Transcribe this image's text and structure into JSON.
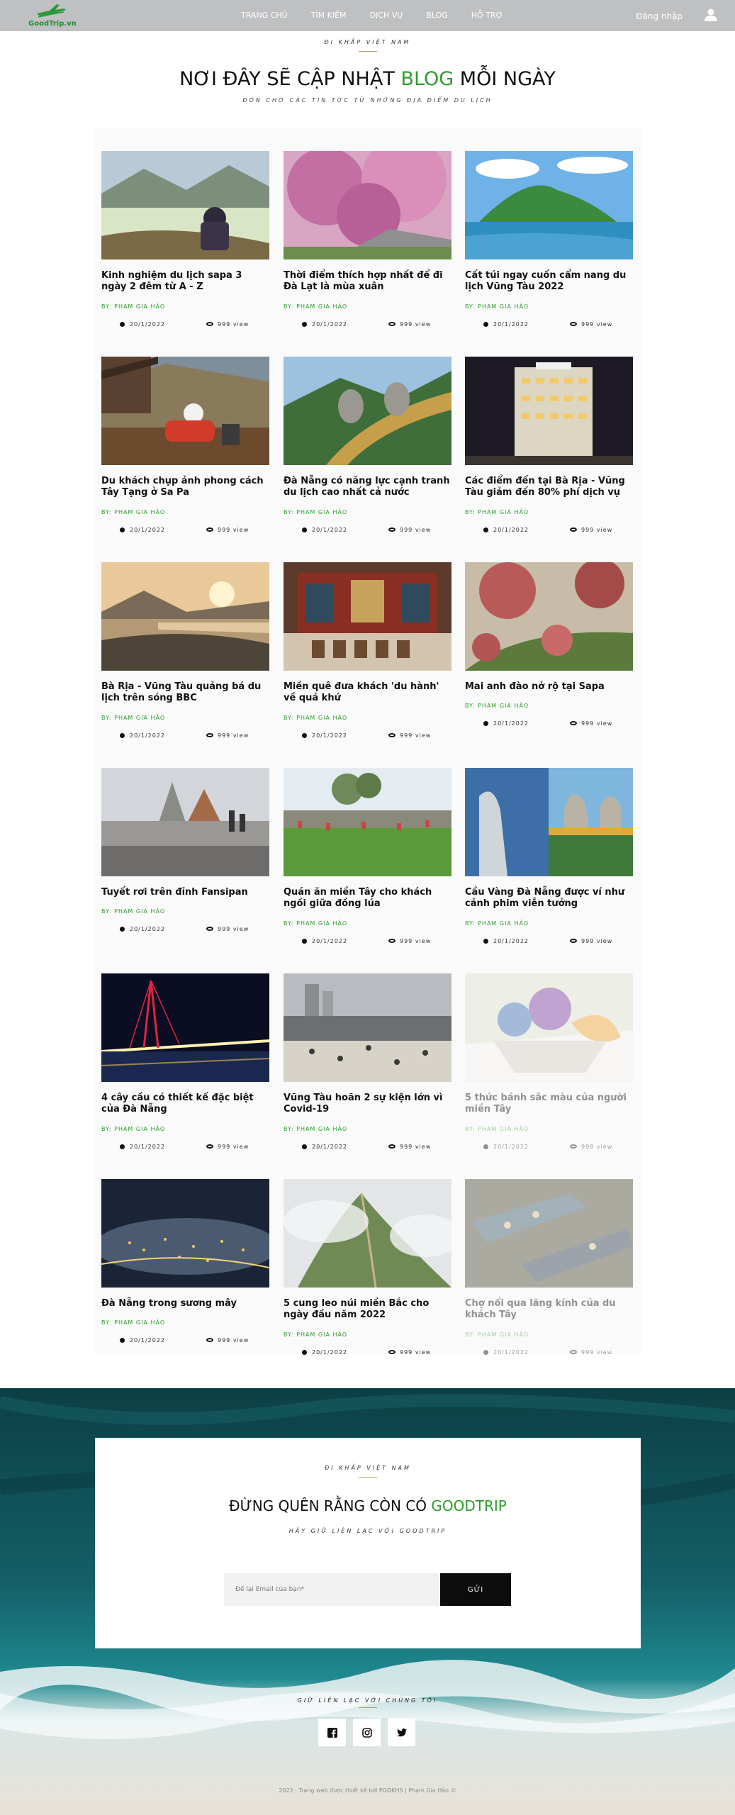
{
  "header": {
    "logo_text": "GoodTrip.vn",
    "nav": [
      "TRANG CHỦ",
      "TÌM KIẾM",
      "DỊCH VỤ",
      "BLOG",
      "HỖ TRỢ"
    ],
    "login_label": "Đăng nhập",
    "icons": {
      "logo": "plane-icon",
      "user": "user-icon"
    }
  },
  "hero": {
    "eyebrow": "ĐI KHẮP VIỆT NAM",
    "title_before": "NƠI ĐÂY SẼ CẬP NHẬT",
    "title_accent": "BLOG",
    "title_after": "MỖI NGÀY",
    "subtitle": "ĐÓN CHỜ CÁC TIN TỨC TỪ NHỮNG ĐỊA ĐIỂM DU LỊCH"
  },
  "posts": [
    {
      "title": "Kinh nghiệm du lịch sapa 3 ngày 2 đêm từ A - Z",
      "author": "BY: PHAM GIA HẢO",
      "date": "20/1/2022",
      "views": "999 view"
    },
    {
      "title": "Thời điểm thích hợp nhất để đi Đà Lạt là mùa xuân",
      "author": "BY: PHAM GIA HẢO",
      "date": "20/1/2022",
      "views": "999 view"
    },
    {
      "title": "Cất túi ngay cuốn cẩm nang du lịch Vũng Tàu 2022",
      "author": "BY: PHAM GIA HẢO",
      "date": "20/1/2022",
      "views": "999 view"
    },
    {
      "title": "Du khách chụp ảnh phong cách Tây Tạng ở Sa Pa",
      "author": "BY: PHAM GIA HẢO",
      "date": "20/1/2022",
      "views": "999 view"
    },
    {
      "title": "Đà Nẵng có năng lực cạnh tranh du lịch cao nhất cả nước",
      "author": "BY: PHAM GIA HẢO",
      "date": "20/1/2022",
      "views": "999 view"
    },
    {
      "title": "Các điểm đến tại Bà Rịa - Vũng Tàu giảm đến 80% phí dịch vụ",
      "author": "BY: PHAM GIA HẢO",
      "date": "20/1/2022",
      "views": "999 view"
    },
    {
      "title": "Bà Rịa - Vũng Tàu quảng bá du lịch trên sóng BBC",
      "author": "BY: PHAM GIA HẢO",
      "date": "20/1/2022",
      "views": "999 view"
    },
    {
      "title": "Miền quê đưa khách 'du hành' về quá khứ",
      "author": "BY: PHAM GIA HẢO",
      "date": "20/1/2022",
      "views": "999 view"
    },
    {
      "title": "Mai anh đào nở rộ tại Sapa",
      "author": "BY: PHAM GIA HẢO",
      "date": "20/1/2022",
      "views": "999 view"
    },
    {
      "title": "Tuyết rơi trên đỉnh Fansipan",
      "author": "BY: PHAM GIA HẢO",
      "date": "20/1/2022",
      "views": "999 view"
    },
    {
      "title": "Quán ăn miền Tây cho khách ngồi giữa đồng lúa",
      "author": "BY: PHAM GIA HẢO",
      "date": "20/1/2022",
      "views": "999 view"
    },
    {
      "title": "Cầu Vàng Đà Nẵng được ví như cảnh phim viễn tưởng",
      "author": "BY: PHAM GIA HẢO",
      "date": "20/1/2022",
      "views": "999 view"
    },
    {
      "title": "4 cây cầu có thiết kế đặc biệt của Đà Nẵng",
      "author": "BY: PHAM GIA HẢO",
      "date": "20/1/2022",
      "views": "999 view"
    },
    {
      "title": "Vũng Tàu hoãn 2 sự kiện lớn vì Covid-19",
      "author": "BY: PHAM GIA HẢO",
      "date": "20/1/2022",
      "views": "999 view"
    },
    {
      "title": "5 thức bánh sắc màu của người miền Tây",
      "author": "BY: PHAM GIA HẢO",
      "date": "20/1/2022",
      "views": "999 view"
    },
    {
      "title": "Đà Nẵng trong sương mây",
      "author": "BY: PHAM GIA HẢO",
      "date": "20/1/2022",
      "views": "999 view"
    },
    {
      "title": "5 cung leo núi miền Bắc cho ngày đầu năm 2022",
      "author": "BY: PHAM GIA HẢO",
      "date": "20/1/2022",
      "views": "999 view"
    },
    {
      "title": "Chợ nổi qua lăng kính của du khách Tây",
      "author": "BY: PHAM GIA HẢO",
      "date": "20/1/2022",
      "views": "999 view"
    }
  ],
  "subscribe": {
    "eyebrow": "ĐI KHẮP VIỆT NAM",
    "title_before": "ĐỪNG QUÊN RẰNG CÒN CÓ",
    "title_accent": "GOODTRIP",
    "subtitle": "HÃY GIỮ LIÊN LẠC VỚI GOODTRIP",
    "email_placeholder": "Để lại Email của bạn*",
    "button_label": "GỬI"
  },
  "contact": {
    "label": "GIỮ LIÊN LẠC VỚI CHÚNG TÔI",
    "socials": [
      "facebook-icon",
      "instagram-icon",
      "twitter-icon"
    ]
  },
  "footer": {
    "text": "2022 · Trang web được thiết kế bởi PGDKHS | Phạm Gia Hảo ©"
  },
  "colors": {
    "accent": "#2e9c2e",
    "header_bg": "#bfc0c2",
    "button_bg": "#0c0c0c",
    "ocean": "#0f4b52"
  }
}
